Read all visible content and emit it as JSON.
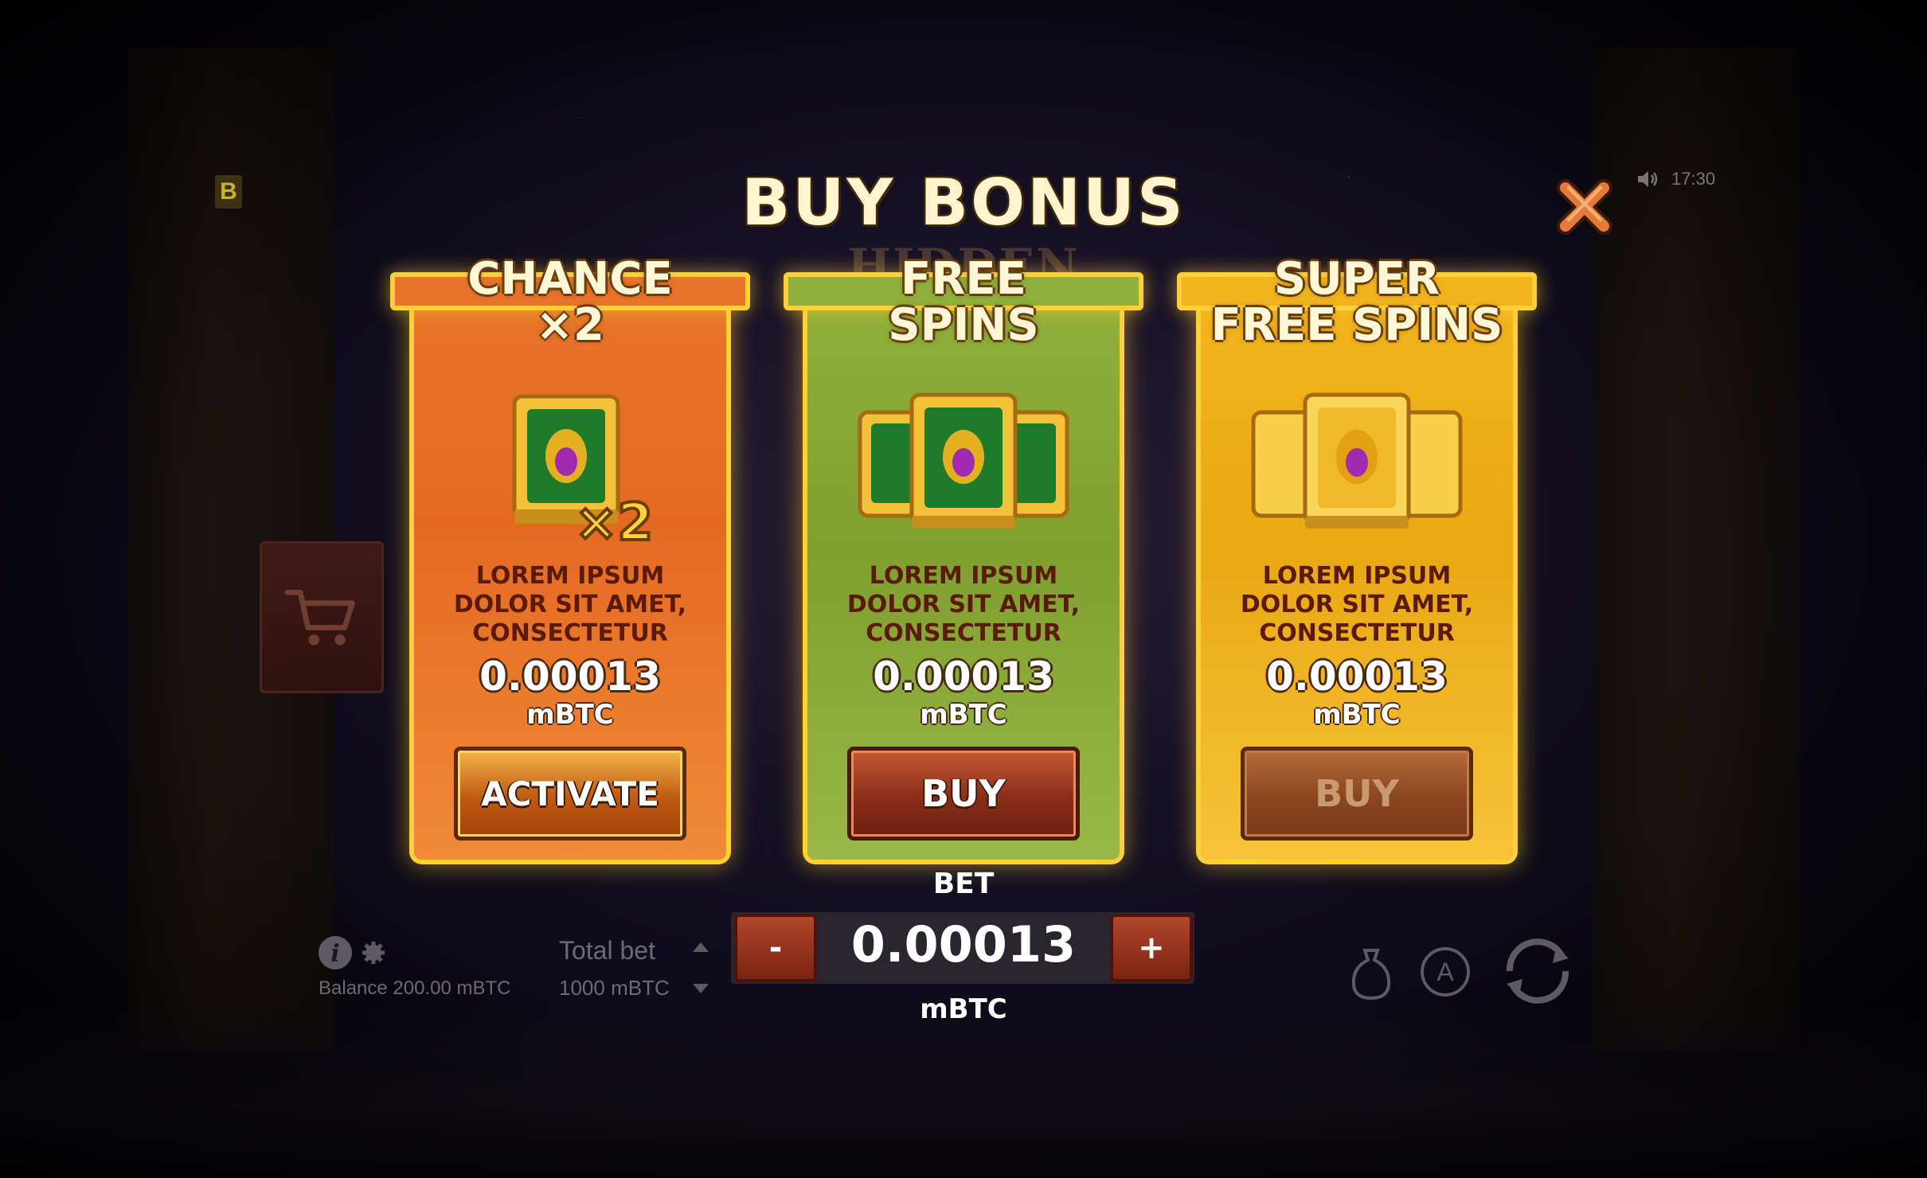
{
  "header": {
    "badge": "B",
    "title": "BUY BONUS",
    "game_logo": "HIDDEN TOMBS",
    "clock": "17:30",
    "sound_icon": "speaker-icon",
    "close_icon": "close-icon"
  },
  "cards": [
    {
      "title_line1": "CHANCE",
      "title_line2": "×2",
      "art_badge": "×2",
      "description_line1": "LOREM IPSUM",
      "description_line2": "DOLOR SIT AMET,",
      "description_line3": "CONSECTETUR",
      "price": "0.00013",
      "unit": "mBTC",
      "button_label": "ACTIVATE",
      "button_state": "active",
      "color": "#e8742a"
    },
    {
      "title_line1": "FREE",
      "title_line2": "SPINS",
      "description_line1": "LOREM IPSUM",
      "description_line2": "DOLOR SIT AMET,",
      "description_line3": "CONSECTETUR",
      "price": "0.00013",
      "unit": "mBTC",
      "button_label": "BUY",
      "button_state": "enabled",
      "color": "#8fb03a"
    },
    {
      "title_line1": "SUPER",
      "title_line2": "FREE SPINS",
      "description_line1": "LOREM IPSUM",
      "description_line2": "DOLOR SIT AMET,",
      "description_line3": "CONSECTETUR",
      "price": "0.00013",
      "unit": "mBTC",
      "button_label": "BUY",
      "button_state": "disabled",
      "color": "#f2b41c"
    }
  ],
  "bet": {
    "label": "BET",
    "minus": "-",
    "plus": "+",
    "value": "0.00013",
    "unit": "mBTC"
  },
  "footer": {
    "balance": "Balance 200.00 mBTC",
    "total_bet_label": "Total bet",
    "total_bet_value": "1000 mBTC",
    "autoplay_letter": "A"
  },
  "colors": {
    "gold_frame": "#ffcf3a",
    "title_text": "#fff4cf"
  }
}
